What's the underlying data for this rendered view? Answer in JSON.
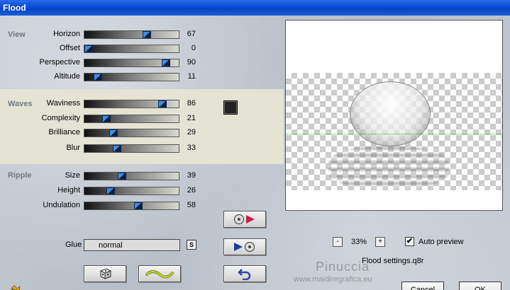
{
  "window": {
    "title": "Flood"
  },
  "sections": {
    "view": "View",
    "waves": "Waves",
    "ripple": "Ripple"
  },
  "sliders": [
    {
      "label": "Horizon",
      "value": "67"
    },
    {
      "label": "Offset",
      "value": "0"
    },
    {
      "label": "Perspective",
      "value": "90"
    },
    {
      "label": "Altitude",
      "value": "11"
    },
    {
      "label": "Waviness",
      "value": "86"
    },
    {
      "label": "Complexity",
      "value": "21"
    },
    {
      "label": "Brilliance",
      "value": "29"
    },
    {
      "label": "Blur",
      "value": "33"
    },
    {
      "label": "Size",
      "value": "39"
    },
    {
      "label": "Height",
      "value": "26"
    },
    {
      "label": "Undulation",
      "value": "58"
    }
  ],
  "glue": {
    "label": "Glue",
    "value": "normal",
    "s_button": "S"
  },
  "preview": {
    "zoom_minus": "-",
    "zoom": "33%",
    "zoom_plus": "+",
    "auto_preview_label": "Auto preview",
    "auto_preview_checked": "✔",
    "settings_file": "Flood settings.q8r"
  },
  "watermark": {
    "name": "Pinuccia",
    "url": "www.maidiregrafica.eu"
  },
  "buttons": {
    "cancel": "Cancel",
    "ok": "OK"
  },
  "colors": {
    "accent": "#0a4ad4",
    "swatch": "#222222"
  }
}
